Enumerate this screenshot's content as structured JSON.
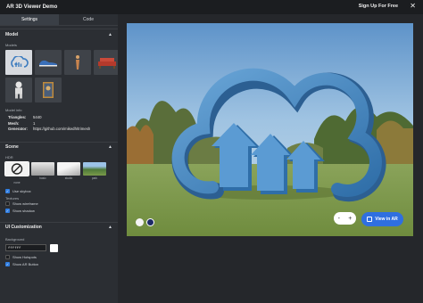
{
  "app": {
    "title": "AR 3D Viewer Demo",
    "signup_label": "Sign Up For Free",
    "close_glyph": "✕"
  },
  "tabs": [
    {
      "label": "Settings"
    },
    {
      "label": "Code"
    }
  ],
  "model_section": {
    "title": "Model",
    "models_label": "Models",
    "model_info_label": "Model info",
    "info": [
      {
        "key": "Triangles:",
        "value": "5440"
      },
      {
        "key": "Mesh:",
        "value": "1"
      },
      {
        "key": "Generator:",
        "value": "https://github.com/mikedh/trimesh"
      }
    ]
  },
  "scene_section": {
    "title": "Scene",
    "hdr_label": "HDR",
    "hdr_options": [
      {
        "caption": "none"
      },
      {
        "caption": "basic"
      },
      {
        "caption": "studio"
      },
      {
        "caption": "park"
      }
    ],
    "use_skybox": "Use skybox",
    "textures_label": "Textures",
    "show_wireframe": "Show wireframe",
    "show_shadow": "Show shadow"
  },
  "ui_section": {
    "title": "UI Customization",
    "background_label": "Background",
    "background_value": "ffffff",
    "show_hotspots": "Show Hotspots",
    "show_ar_button": "Show AR Button"
  },
  "viewer": {
    "zoom_minus": "-",
    "zoom_plus": "+",
    "ar_button_label": "View in AR",
    "accent": "#2f6fe0"
  }
}
